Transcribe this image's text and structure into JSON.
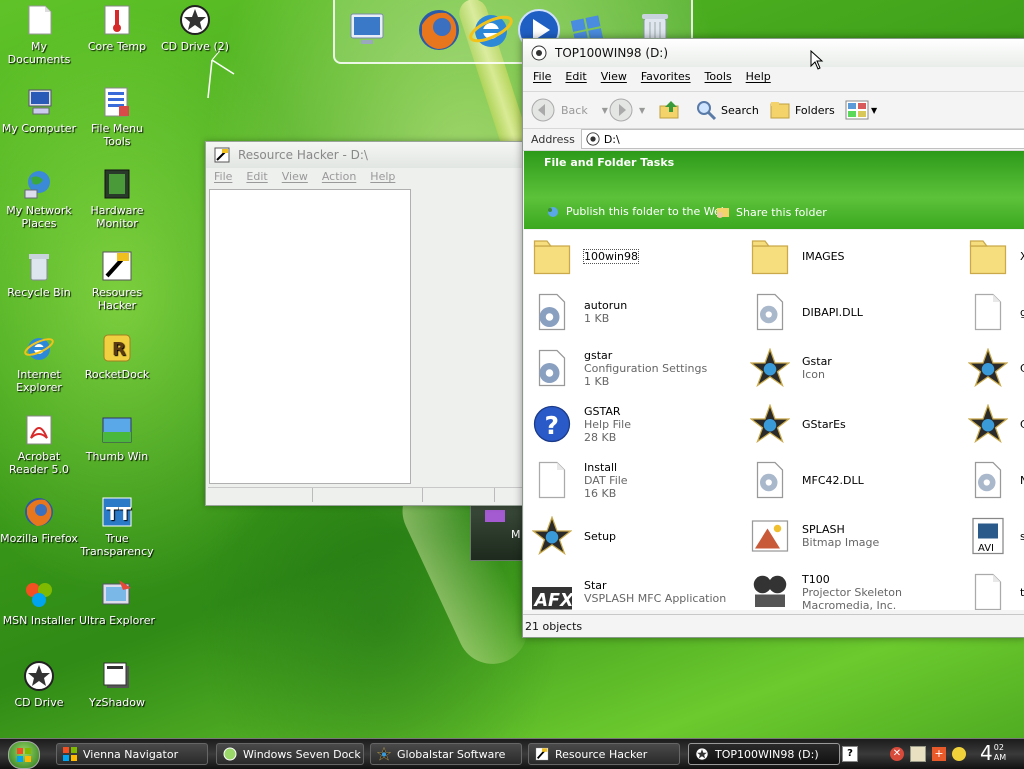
{
  "desktop_icons": [
    {
      "label": "My Documents",
      "icon": "document-icon"
    },
    {
      "label": "Core Temp",
      "icon": "thermometer-icon"
    },
    {
      "label": "CD Drive (2)",
      "icon": "cd-drive-icon"
    },
    {
      "label": "My Computer",
      "icon": "computer-icon"
    },
    {
      "label": "File Menu Tools",
      "icon": "file-menu-tools-icon"
    },
    {
      "label": "My Network Places",
      "icon": "network-icon"
    },
    {
      "label": "Hardware Monitor",
      "icon": "chip-icon"
    },
    {
      "label": "Recycle Bin",
      "icon": "recycle-bin-icon"
    },
    {
      "label": "Resoures Hacker",
      "icon": "hacker-icon"
    },
    {
      "label": "Internet Explorer",
      "icon": "ie-icon"
    },
    {
      "label": "RocketDock",
      "icon": "rocketdock-icon"
    },
    {
      "label": "Acrobat Reader 5.0",
      "icon": "acrobat-icon"
    },
    {
      "label": "Thumb Win",
      "icon": "thumbwin-icon"
    },
    {
      "label": "Mozilla Firefox",
      "icon": "firefox-icon"
    },
    {
      "label": "True Transparency",
      "icon": "transparency-icon"
    },
    {
      "label": "MSN Installer",
      "icon": "msn-icon"
    },
    {
      "label": "Ultra Explorer",
      "icon": "ultra-explorer-icon"
    },
    {
      "label": "CD Drive",
      "icon": "cd-drive-icon"
    },
    {
      "label": "YzShadow",
      "icon": "yzshadow-icon"
    }
  ],
  "dock": {
    "items": [
      "monitor-icon",
      "firefox-icon",
      "ie-icon",
      "media-player-icon",
      "windows-flag-icon",
      "recycle-bin-icon"
    ]
  },
  "resource_hacker": {
    "title": "Resource Hacker - D:\\",
    "menu": [
      "File",
      "Edit",
      "View",
      "Action",
      "Help"
    ]
  },
  "explorer": {
    "title": "TOP100WIN98 (D:)",
    "menu": [
      "File",
      "Edit",
      "View",
      "Favorites",
      "Tools",
      "Help"
    ],
    "toolbar": {
      "back": "Back",
      "search": "Search",
      "folders": "Folders"
    },
    "address_label": "Address",
    "address_value": "D:\\",
    "tasks_title": "File and Folder Tasks",
    "task_publish": "Publish this folder to the Web",
    "task_share": "Share this folder",
    "files": [
      {
        "name": "100win98",
        "sub1": "",
        "sub2": "",
        "icon": "folder-icon"
      },
      {
        "name": "IMAGES",
        "sub1": "",
        "sub2": "",
        "icon": "folder-icon"
      },
      {
        "name": "X",
        "sub1": "",
        "sub2": "",
        "icon": "folder-icon"
      },
      {
        "name": "autorun",
        "sub1": "1 KB",
        "sub2": "",
        "icon": "settings-file-icon"
      },
      {
        "name": "DIBAPI.DLL",
        "sub1": "",
        "sub2": "",
        "icon": "dll-icon"
      },
      {
        "name": "g",
        "sub1": "",
        "sub2": "",
        "icon": "blank-file-icon"
      },
      {
        "name": "gstar",
        "sub1": "Configuration Settings",
        "sub2": "1 KB",
        "icon": "settings-file-icon"
      },
      {
        "name": "Gstar",
        "sub1": "Icon",
        "sub2": "",
        "icon": "star-icon"
      },
      {
        "name": "C",
        "sub1": "",
        "sub2": "",
        "icon": "star-icon"
      },
      {
        "name": "GSTAR",
        "sub1": "Help File",
        "sub2": "28 KB",
        "icon": "help-icon"
      },
      {
        "name": "GStarEs",
        "sub1": "",
        "sub2": "",
        "icon": "star-icon"
      },
      {
        "name": "C",
        "sub1": "",
        "sub2": "",
        "icon": "star-icon"
      },
      {
        "name": "Install",
        "sub1": "DAT File",
        "sub2": "16 KB",
        "icon": "blank-file-icon"
      },
      {
        "name": "MFC42.DLL",
        "sub1": "",
        "sub2": "",
        "icon": "dll-icon"
      },
      {
        "name": "N",
        "sub1": "",
        "sub2": "",
        "icon": "dll-icon"
      },
      {
        "name": "Setup",
        "sub1": "",
        "sub2": "",
        "icon": "star-icon"
      },
      {
        "name": "SPLASH",
        "sub1": "Bitmap Image",
        "sub2": "",
        "icon": "bitmap-icon"
      },
      {
        "name": "s",
        "sub1": "",
        "sub2": "",
        "icon": "avi-icon"
      },
      {
        "name": "Star",
        "sub1": "VSPLASH MFC Application",
        "sub2": "",
        "icon": "afx-icon"
      },
      {
        "name": "T100",
        "sub1": "Projector Skeleton",
        "sub2": "Macromedia, Inc.",
        "icon": "projector-icon"
      },
      {
        "name": "t",
        "sub1": "",
        "sub2": "",
        "icon": "blank-file-icon"
      }
    ],
    "status": "21 objects"
  },
  "behind_window_label": "M",
  "taskbar": {
    "buttons": [
      {
        "label": "Vienna Navigator",
        "icon": "windows-flag-icon"
      },
      {
        "label": "Windows Seven Dock",
        "icon": "dock-icon"
      },
      {
        "label": "Globalstar Software",
        "icon": "star-icon"
      },
      {
        "label": "Resource Hacker",
        "icon": "hacker-icon"
      },
      {
        "label": "TOP100WIN98 (D:)",
        "icon": "cd-drive-icon"
      }
    ],
    "clock_hour": "4",
    "clock_min": "02",
    "clock_ampm": "AM"
  },
  "colors": {
    "explorer_green": "#2fa01c",
    "taskbar": "#222222"
  }
}
